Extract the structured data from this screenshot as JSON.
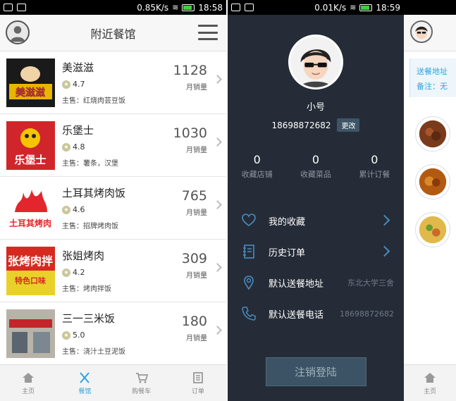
{
  "left": {
    "status": {
      "speed": "0.85K/s",
      "time": "18:58"
    },
    "header": {
      "title": "附近餐馆"
    },
    "restaurants": [
      {
        "name": "美滋滋",
        "rating": "4.7",
        "main": "主售：红烧肉芸豆饭",
        "sales": "1128",
        "sales_label": "月销量"
      },
      {
        "name": "乐堡士",
        "rating": "4.8",
        "main": "主售：薯条，汉堡",
        "sales": "1030",
        "sales_label": "月销量"
      },
      {
        "name": "土耳其烤肉饭",
        "rating": "4.6",
        "main": "主售：招牌烤肉饭",
        "sales": "765",
        "sales_label": "月销量"
      },
      {
        "name": "张姐烤肉",
        "rating": "4.2",
        "main": "主售：烤肉拌饭",
        "sales": "309",
        "sales_label": "月销量"
      },
      {
        "name": "三一三米饭",
        "rating": "5.0",
        "main": "主售：浇汁土豆泥饭",
        "sales": "180",
        "sales_label": "月销量"
      }
    ],
    "tabs": [
      {
        "label": "主页",
        "icon": "home-icon"
      },
      {
        "label": "餐馆",
        "icon": "utensils-icon"
      },
      {
        "label": "购餐车",
        "icon": "cart-icon"
      },
      {
        "label": "订单",
        "icon": "order-icon"
      }
    ],
    "active_tab": "餐馆"
  },
  "middle": {
    "status": {
      "speed": "0.01K/s",
      "time": "18:59"
    },
    "nickname": "小号",
    "phone": "18698872682",
    "change_label": "更改",
    "stats": [
      {
        "value": "0",
        "label": "收藏店铺"
      },
      {
        "value": "0",
        "label": "收藏菜品"
      },
      {
        "value": "0",
        "label": "累计订餐"
      }
    ],
    "menu": [
      {
        "label": "我的收藏",
        "value": "",
        "icon": "heart-icon"
      },
      {
        "label": "历史订单",
        "value": "",
        "icon": "notebook-icon"
      },
      {
        "label": "默认送餐地址",
        "value": "东北大学三舍",
        "icon": "location-pin-icon"
      },
      {
        "label": "默认送餐电话",
        "value": "18698872682",
        "icon": "phone-icon"
      }
    ],
    "logout_label": "注销登陆"
  },
  "right": {
    "address_label": "送餐地址",
    "note_label": "备注：无",
    "tab_label": "主页"
  },
  "colors": {
    "accent": "#2ba3e0",
    "panel": "#252c37"
  }
}
